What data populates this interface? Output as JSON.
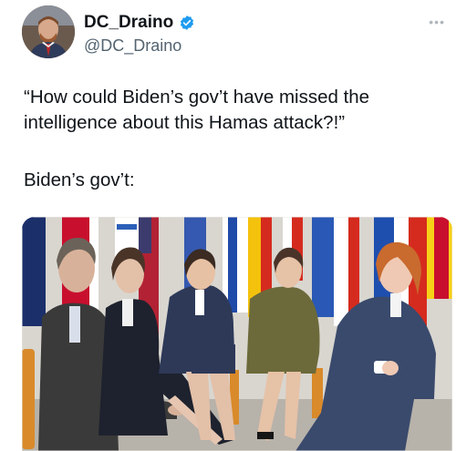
{
  "tweet": {
    "author": {
      "display_name": "DC_Draino",
      "handle": "@DC_Draino",
      "verified": true
    },
    "text_line1": "“How could Biden’s gov’t have missed the intelligence about this Hamas attack?!”",
    "text_line2": "Biden’s gov’t:",
    "more_icon": "more-dots-icon",
    "verified_icon": "verified-badge-icon",
    "media": {
      "image": "photo-group-in-military-uniforms"
    }
  },
  "colors": {
    "verified": "#1d9bf0",
    "text": "#0f1419",
    "secondary": "#536471"
  }
}
